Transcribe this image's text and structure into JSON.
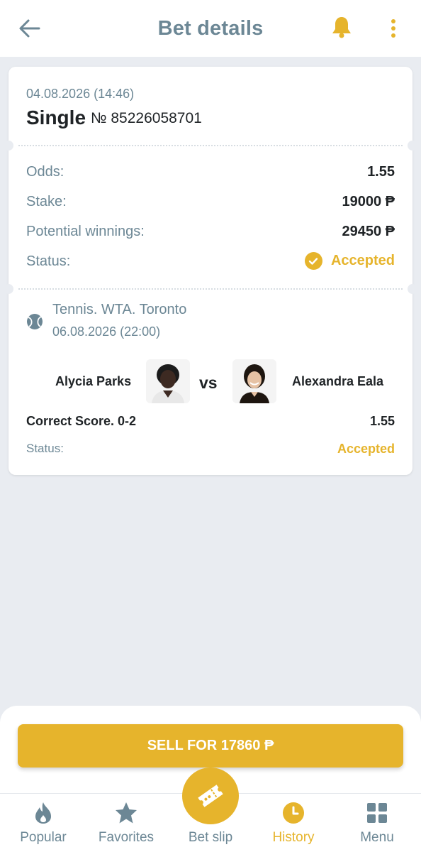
{
  "header": {
    "title": "Bet details",
    "back_icon": "arrow-left-icon",
    "bell_icon": "bell-icon",
    "more_icon": "more-vertical-icon"
  },
  "bet": {
    "date": "04.08.2026 (14:46)",
    "type": "Single",
    "number": "№ 85226058701",
    "rows": [
      {
        "label": "Odds:",
        "value": "1.55"
      },
      {
        "label": "Stake:",
        "value": "19000 ₱"
      },
      {
        "label": "Potential winnings:",
        "value": "29450 ₱"
      }
    ],
    "status_label": "Status:",
    "status_value": "Accepted"
  },
  "event": {
    "league": "Tennis. WTA. Toronto",
    "date": "06.08.2026 (22:00)",
    "player1": "Alycia Parks",
    "player2": "Alexandra Eala",
    "vs": "vs",
    "market": "Correct Score. 0-2",
    "odds": "1.55",
    "status_label": "Status:",
    "status_value": "Accepted"
  },
  "sell": {
    "label": "SELL FOR 17860 ₱"
  },
  "nav": {
    "items": [
      {
        "label": "Popular",
        "icon": "flame-icon"
      },
      {
        "label": "Favorites",
        "icon": "star-icon"
      },
      {
        "label": "Bet slip",
        "icon": "ticket-icon"
      },
      {
        "label": "History",
        "icon": "clock-icon"
      },
      {
        "label": "Menu",
        "icon": "grid-icon"
      }
    ],
    "active": "History"
  },
  "colors": {
    "accent": "#e6b42c",
    "muted": "#6c8795",
    "background": "#e9ecf1",
    "text": "#1f2326"
  }
}
